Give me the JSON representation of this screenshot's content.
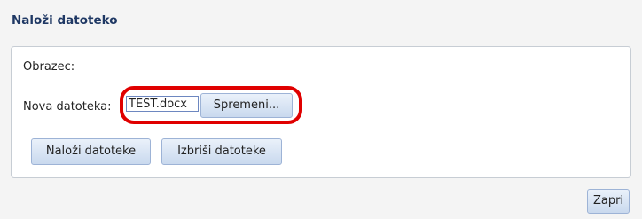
{
  "dialog": {
    "title": "Naloži datoteko"
  },
  "form": {
    "label": "Obrazec:",
    "file_label": "Nova datoteka:",
    "file_name": "TEST.docx",
    "change_button": "Spremeni...",
    "upload_button": "Naloži datoteke",
    "delete_button": "Izbriši datoteke"
  },
  "footer": {
    "close_button": "Zapri"
  },
  "colors": {
    "highlight": "#e00000",
    "button_border": "#9db3d6",
    "title": "#1f3864"
  }
}
